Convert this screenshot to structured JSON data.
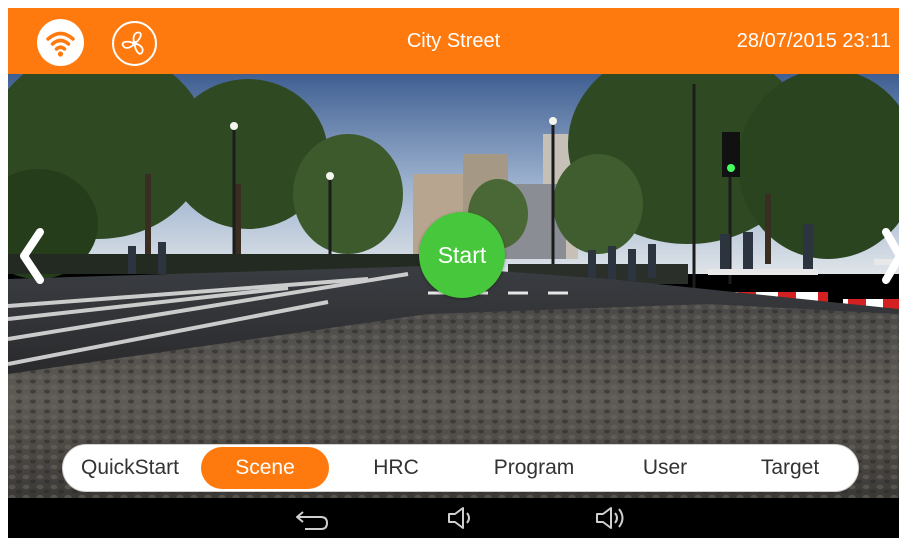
{
  "header": {
    "title": "City Street",
    "datetime": "28/07/2015 23:11",
    "icons": {
      "wifi": "wifi-icon",
      "fan": "fan-icon"
    }
  },
  "scene": {
    "start_label": "Start",
    "nav": {
      "prev": "chevron-left-icon",
      "next": "chevron-right-icon"
    }
  },
  "tabs": {
    "items": [
      "QuickStart",
      "Scene",
      "HRC",
      "Program",
      "User",
      "Target"
    ],
    "active": "Scene"
  },
  "system_nav": {
    "icons": [
      "back-icon",
      "volume-down-icon",
      "volume-up-icon"
    ]
  },
  "colors": {
    "accent": "#ff7a0e",
    "start": "#47c83c",
    "nav_bar": "#000000"
  }
}
